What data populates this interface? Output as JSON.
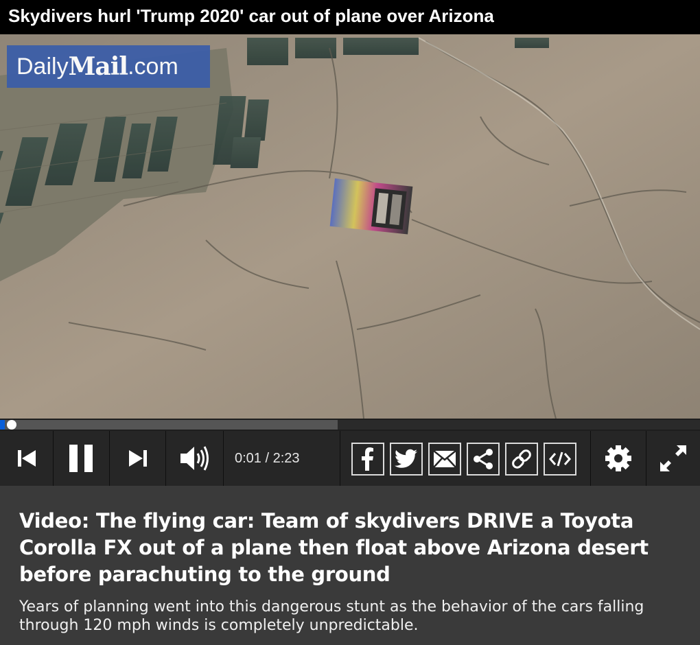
{
  "headline": "Skydivers hurl 'Trump 2020' car out of plane over Arizona",
  "video": {
    "logo": {
      "daily": "Daily",
      "mail": "Mail",
      "dotcom": ".com"
    },
    "progress": {
      "played_fraction": 0.007,
      "buffered_fraction": 0.482
    }
  },
  "controls": {
    "time_display": "0:01 / 2:23",
    "buttons": [
      "previous",
      "pause",
      "next",
      "volume"
    ],
    "share_buttons": [
      "facebook",
      "twitter",
      "email",
      "share",
      "link",
      "embed"
    ],
    "settings": "settings",
    "fullscreen": "fullscreen"
  },
  "caption": {
    "title": "Video: The flying car: Team of skydivers DRIVE a Toyota Corolla FX out of a plane then float above Arizona desert before parachuting to the ground",
    "description": "Years of planning went into this dangerous stunt as the behavior of the cars falling through 120 mph winds is completely unpredictable."
  },
  "colors": {
    "accent": "#0a5fd8",
    "logo_bg": "#3d5ea8",
    "control_bar": "#262626",
    "caption_bg": "#3a3a3a"
  },
  "icons": [
    "previous-icon",
    "pause-icon",
    "next-icon",
    "volume-icon",
    "facebook-icon",
    "twitter-icon",
    "email-icon",
    "share-icon",
    "link-icon",
    "embed-icon",
    "gear-icon",
    "fullscreen-icon"
  ]
}
